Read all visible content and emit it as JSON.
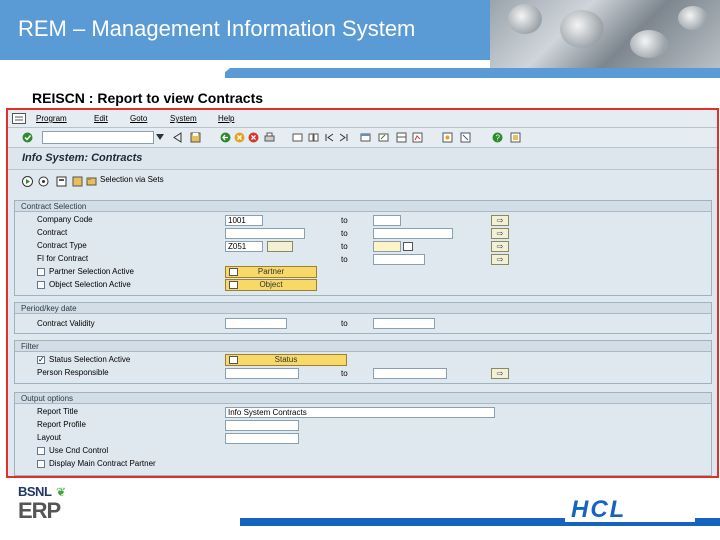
{
  "slide": {
    "title": "REM – Management Information System",
    "subtitle": "REISCN : Report to view Contracts"
  },
  "menu": {
    "items": [
      "Program",
      "Edit",
      "Goto",
      "System",
      "Help"
    ]
  },
  "app": {
    "title": "Info System: Contracts",
    "selection_via_sets": "Selection via Sets"
  },
  "contract_selection": {
    "header": "Contract Selection",
    "company_code_label": "Company Code",
    "company_code_value": "1001",
    "contract_label": "Contract",
    "contract_type_label": "Contract Type",
    "contract_type_value": "Z051",
    "fl_for_contract_label": "FI for Contract",
    "partner_selection_label": "Partner Selection Active",
    "object_selection_label": "Object Selection Active",
    "partner_button": "Partner",
    "object_button": "Object",
    "to_label": "to"
  },
  "period_key_date": {
    "header": "Period/key date",
    "contract_validity_label": "Contract Validity",
    "to_label": "to"
  },
  "filter": {
    "header": "Filter",
    "status_selection_label": "Status Selection Active",
    "status_selection_checked": true,
    "status_button": "Status",
    "person_responsible_label": "Person Responsible",
    "to_label": "to"
  },
  "output_options": {
    "header": "Output options",
    "report_title_label": "Report Title",
    "report_title_value": "Info System  Contracts",
    "report_profile_label": "Report Profile",
    "layout_label": "Layout",
    "use_cnd_control_label": "Use Cnd Control",
    "display_main_partner_label": "Display Main Contract Partner"
  },
  "footer": {
    "bsnl": "BSNL",
    "erp": "ERP",
    "hcl": "HCL"
  },
  "colors": {
    "title_bar": "#5b9bd5",
    "frame_border": "#e0302a",
    "hcl_blue": "#1565c0"
  }
}
